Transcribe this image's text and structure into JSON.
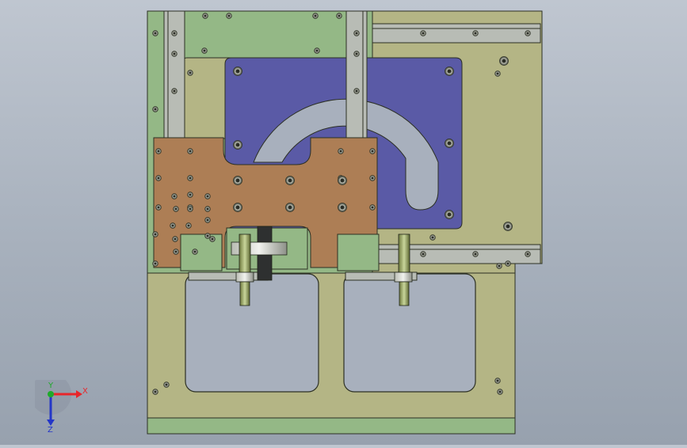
{
  "viewport": {
    "background_top": "#bfc6d0",
    "background_bottom": "#97a1ae"
  },
  "model": {
    "colors": {
      "base_plate": "#b4b585",
      "green_frame": "#94b886",
      "gray_rail": "#b8bcb5",
      "blue_plate": "#5a5aa6",
      "copper_plate": "#ad7e55",
      "slot": "#a8b0bd",
      "edge": "#2c3024"
    }
  },
  "triad": {
    "x_label": "X",
    "y_label": "Y",
    "z_label": "Z",
    "x_color": "#e8262a",
    "y_color": "#1faa2a",
    "z_color": "#2436c8"
  }
}
